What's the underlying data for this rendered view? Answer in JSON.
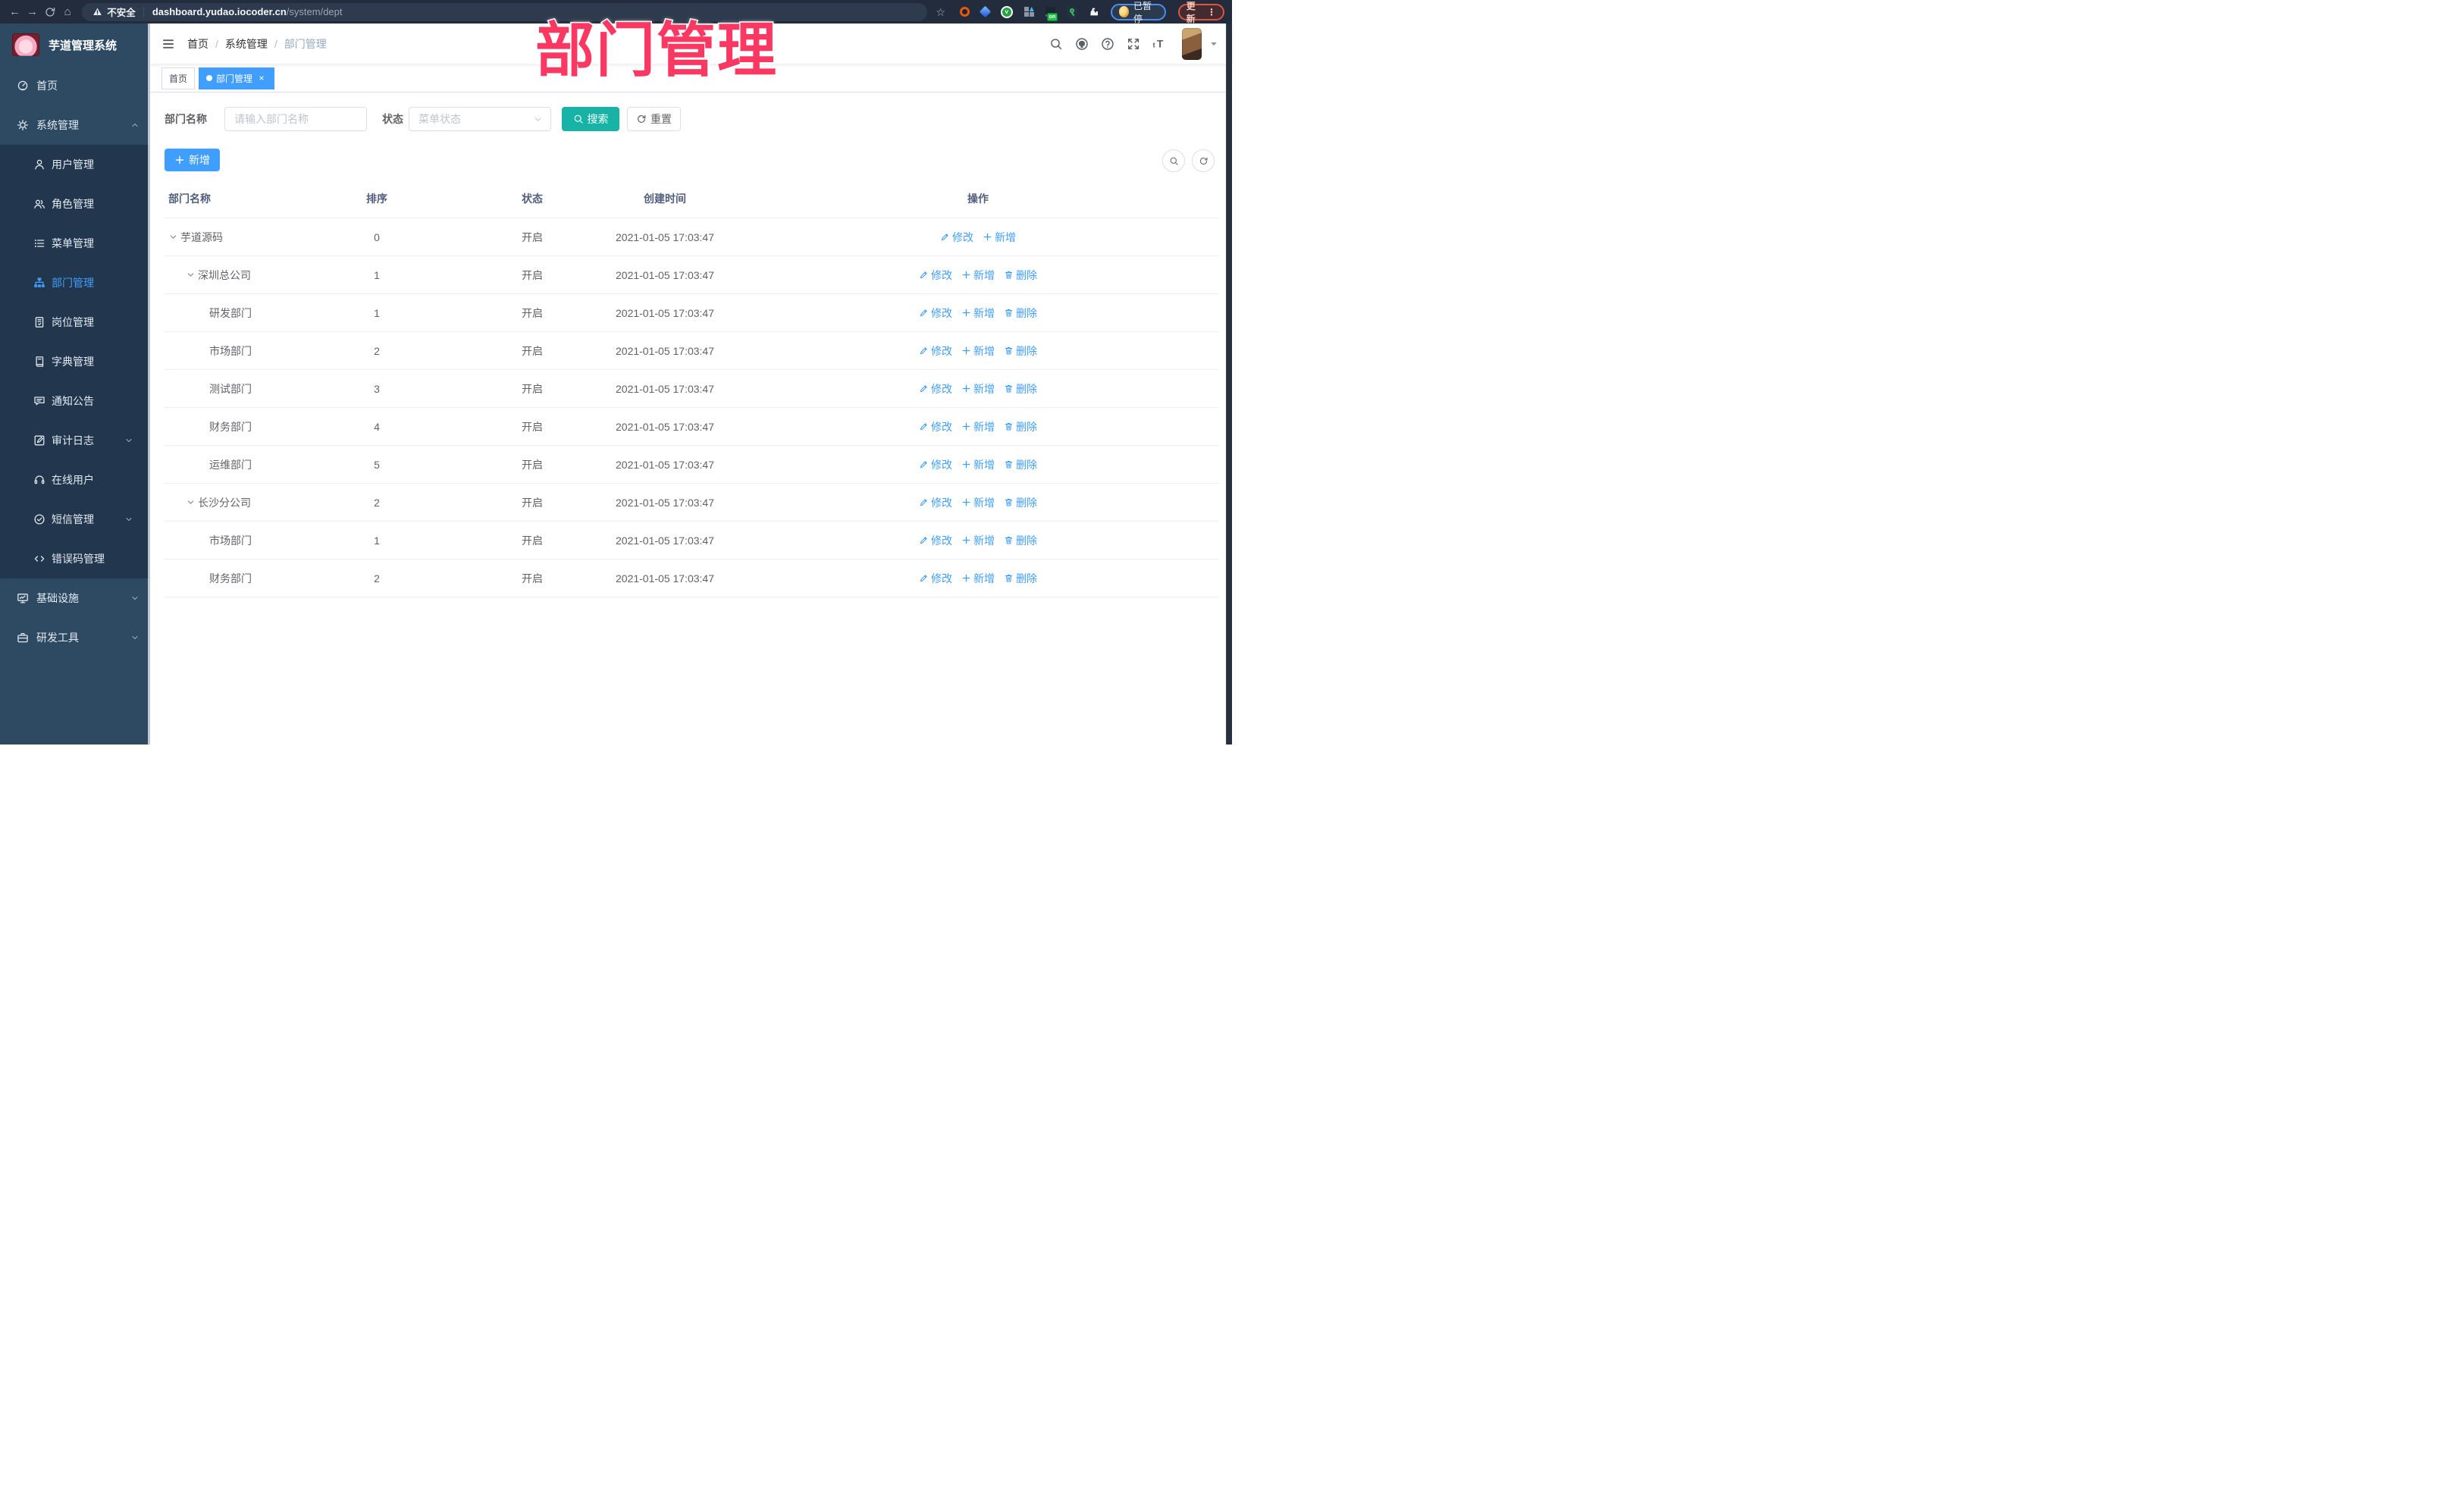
{
  "browser": {
    "security_label": "不安全",
    "url_host": "dashboard.yudao.iocoder.cn",
    "url_path": "/system/dept",
    "extension_badge": "on",
    "profile_status": "已暂停",
    "update_label": "更新"
  },
  "sidebar": {
    "title": "芋道管理系统",
    "menu": [
      {
        "label": "首页",
        "icon": "dashboard-icon",
        "level": 0
      },
      {
        "label": "系统管理",
        "icon": "gear-icon",
        "level": 0,
        "chevron": "up"
      },
      {
        "label": "用户管理",
        "icon": "user-icon",
        "level": 1
      },
      {
        "label": "角色管理",
        "icon": "users-icon",
        "level": 1
      },
      {
        "label": "菜单管理",
        "icon": "menu-list-icon",
        "level": 1
      },
      {
        "label": "部门管理",
        "icon": "org-tree-icon",
        "level": 1,
        "active": true
      },
      {
        "label": "岗位管理",
        "icon": "badge-icon",
        "level": 1
      },
      {
        "label": "字典管理",
        "icon": "dictionary-icon",
        "level": 1
      },
      {
        "label": "通知公告",
        "icon": "announcement-icon",
        "level": 1
      },
      {
        "label": "审计日志",
        "icon": "audit-log-icon",
        "level": 1,
        "chevron": "down"
      },
      {
        "label": "在线用户",
        "icon": "online-users-icon",
        "level": 1
      },
      {
        "label": "短信管理",
        "icon": "sms-check-icon",
        "level": 1,
        "chevron": "down"
      },
      {
        "label": "错误码管理",
        "icon": "code-icon",
        "level": 1
      },
      {
        "label": "基础设施",
        "icon": "infrastructure-icon",
        "level": 0,
        "chevron": "down"
      },
      {
        "label": "研发工具",
        "icon": "dev-tools-icon",
        "level": 0,
        "chevron": "down"
      }
    ]
  },
  "header": {
    "breadcrumb": [
      "首页",
      "系统管理",
      "部门管理"
    ],
    "breadcrumb_separator": "/"
  },
  "tags": [
    {
      "label": "首页",
      "active": false,
      "closable": false
    },
    {
      "label": "部门管理",
      "active": true,
      "closable": true
    }
  ],
  "overlay_title": "部门管理",
  "filters": {
    "dept_label": "部门名称",
    "dept_placeholder": "请输入部门名称",
    "status_label": "状态",
    "status_placeholder": "菜单状态",
    "search_label": "搜索",
    "reset_label": "重置"
  },
  "toolbar": {
    "add_label": "新增"
  },
  "table": {
    "headers": [
      "部门名称",
      "排序",
      "状态",
      "创建时间",
      "操作"
    ],
    "rows": [
      {
        "name": "芋道源码",
        "indent": 0,
        "expandable": true,
        "sort": "0",
        "status": "开启",
        "created": "2021-01-05 17:03:47",
        "actions": [
          "修改",
          "新增"
        ]
      },
      {
        "name": "深圳总公司",
        "indent": 1,
        "expandable": true,
        "sort": "1",
        "status": "开启",
        "created": "2021-01-05 17:03:47",
        "actions": [
          "修改",
          "新增",
          "删除"
        ]
      },
      {
        "name": "研发部门",
        "indent": 2,
        "expandable": false,
        "sort": "1",
        "status": "开启",
        "created": "2021-01-05 17:03:47",
        "actions": [
          "修改",
          "新增",
          "删除"
        ]
      },
      {
        "name": "市场部门",
        "indent": 2,
        "expandable": false,
        "sort": "2",
        "status": "开启",
        "created": "2021-01-05 17:03:47",
        "actions": [
          "修改",
          "新增",
          "删除"
        ]
      },
      {
        "name": "测试部门",
        "indent": 2,
        "expandable": false,
        "sort": "3",
        "status": "开启",
        "created": "2021-01-05 17:03:47",
        "actions": [
          "修改",
          "新增",
          "删除"
        ]
      },
      {
        "name": "财务部门",
        "indent": 2,
        "expandable": false,
        "sort": "4",
        "status": "开启",
        "created": "2021-01-05 17:03:47",
        "actions": [
          "修改",
          "新增",
          "删除"
        ]
      },
      {
        "name": "运维部门",
        "indent": 2,
        "expandable": false,
        "sort": "5",
        "status": "开启",
        "created": "2021-01-05 17:03:47",
        "actions": [
          "修改",
          "新增",
          "删除"
        ]
      },
      {
        "name": "长沙分公司",
        "indent": 1,
        "expandable": true,
        "sort": "2",
        "status": "开启",
        "created": "2021-01-05 17:03:47",
        "actions": [
          "修改",
          "新增",
          "删除"
        ]
      },
      {
        "name": "市场部门",
        "indent": 2,
        "expandable": false,
        "sort": "1",
        "status": "开启",
        "created": "2021-01-05 17:03:47",
        "actions": [
          "修改",
          "新增",
          "删除"
        ]
      },
      {
        "name": "财务部门",
        "indent": 2,
        "expandable": false,
        "sort": "2",
        "status": "开启",
        "created": "2021-01-05 17:03:47",
        "actions": [
          "修改",
          "新增",
          "删除"
        ]
      }
    ]
  },
  "colors": {
    "primary_blue": "#409eff",
    "search_teal": "#17b3a6",
    "overlay_pink": "#fa3862",
    "sidebar_bg": "#2e4a63",
    "submenu_bg": "#22374e",
    "browser_bar_bg": "#222c3c"
  }
}
